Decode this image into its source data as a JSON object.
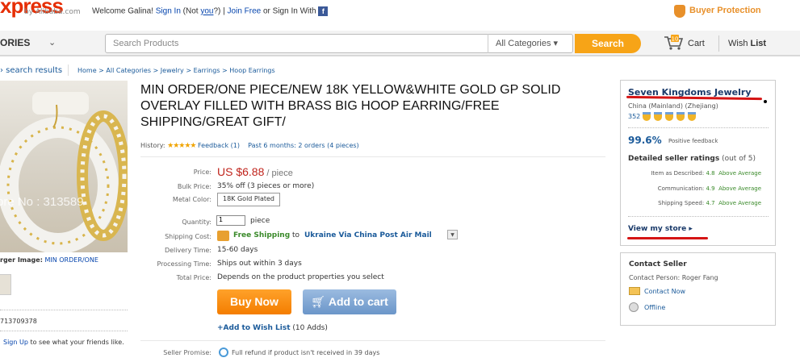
{
  "header": {
    "logo_text": "xpress",
    "logo_sub": "by Alibaba.com",
    "welcome": "Welcome Galina!",
    "sign_in": "Sign In",
    "not_prefix": "(Not ",
    "not_you": "you",
    "not_suffix": "?) |",
    "join_free": "Join Free",
    "or_sign_in_with": "or Sign In With",
    "fb_glyph": "f",
    "buyer_protection": "Buyer Protection"
  },
  "nav": {
    "categories": "ORIES",
    "search_placeholder": "Search Products",
    "all_categories": "All Categories ▾",
    "search_button": "Search",
    "cart_count": "10",
    "cart": "Cart",
    "wish_prefix": "Wish ",
    "wish_bold": "List"
  },
  "breadcrumb": {
    "back": "› search results",
    "path": "Home > All Categories > Jewelry > Earrings > Hoop Earrings"
  },
  "gallery": {
    "watermark": "ore No : 313589",
    "larger_label": "rger Image:",
    "larger_link": "MIN ORDER/ONE",
    "product_id": "713709378",
    "signup_link": "Sign Up",
    "signup_text": " to see what your friends like."
  },
  "product": {
    "title": "MIN ORDER/ONE PIECE/NEW 18K YELLOW&WHITE GOLD GP SOLID OVERLAY FILLED WITH BRASS BIG HOOP EARRING/FREE SHIPPING/GREAT GIFT/",
    "history_label": "History:",
    "stars": "★★★★★",
    "feedback": "Feedback (1)",
    "past_orders": "Past 6 months: 2 orders (4 pieces)",
    "price_label": "Price:",
    "price": "US $6.88",
    "price_unit": " / piece",
    "bulk_label": "Bulk Price:",
    "bulk_value": "35% off (3 pieces or more)",
    "metal_label": "Metal Color:",
    "metal_value": "18K Gold Plated",
    "qty_label": "Quantity:",
    "qty_value": "1",
    "qty_unit": "piece",
    "shipping_label": "Shipping Cost:",
    "free_shipping": "Free Shipping",
    "to_word": "to",
    "ship_method": "Ukraine Via China Post Air Mail",
    "delivery_label": "Delivery Time:",
    "delivery_value": "15-60 days",
    "processing_label": "Processing Time:",
    "processing_value": "Ships out within 3 days",
    "total_label": "Total Price:",
    "total_value": "Depends on the product properties you select",
    "buy_now": "Buy Now",
    "add_to_cart": "Add to cart",
    "add_wish": "+Add to Wish List",
    "wish_adds": " (10 Adds)",
    "promise_label": "Seller Promise:",
    "promise_text": "Full refund if product isn't received in 39 days"
  },
  "seller": {
    "store_name": "Seven Kingdoms Jewelry",
    "location": "China (Mainland) (Zhejiang)",
    "score": "352",
    "positive_pct": "99.6%",
    "positive_label": "Positive feedback",
    "dsr_title": "Detailed seller ratings",
    "dsr_out_of": " (out of 5)",
    "ratings": [
      {
        "label": "Item as Described:",
        "score": "4.8",
        "level": "Above Average"
      },
      {
        "label": "Communication:",
        "score": "4.9",
        "level": "Above Average"
      },
      {
        "label": "Shipping Speed:",
        "score": "4.7",
        "level": "Above Average"
      }
    ],
    "view_store": "View my store ▸",
    "contact_title": "Contact Seller",
    "contact_person": "Contact Person: Roger Fang",
    "contact_now": "Contact Now",
    "offline": "Offline"
  },
  "colors": {
    "brand_red": "#e62e04",
    "search_orange": "#f7a417",
    "buy_orange": "#f47d00",
    "cart_blue": "#6b96c9",
    "link_blue": "#1a5a9a"
  }
}
